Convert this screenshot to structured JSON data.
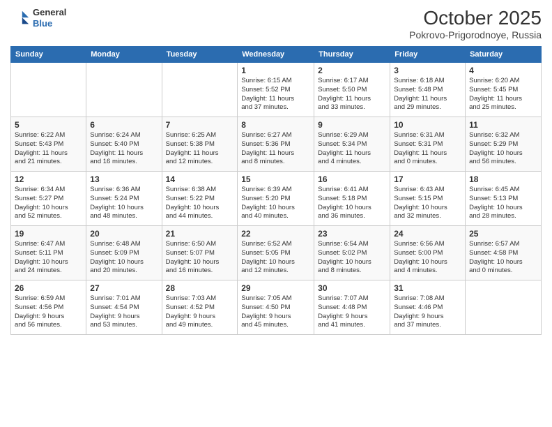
{
  "header": {
    "logo": {
      "line1": "General",
      "line2": "Blue"
    },
    "title": "October 2025",
    "location": "Pokrovo-Prigorodnoye, Russia"
  },
  "weekdays": [
    "Sunday",
    "Monday",
    "Tuesday",
    "Wednesday",
    "Thursday",
    "Friday",
    "Saturday"
  ],
  "weeks": [
    [
      {
        "day": "",
        "info": ""
      },
      {
        "day": "",
        "info": ""
      },
      {
        "day": "",
        "info": ""
      },
      {
        "day": "1",
        "info": "Sunrise: 6:15 AM\nSunset: 5:52 PM\nDaylight: 11 hours\nand 37 minutes."
      },
      {
        "day": "2",
        "info": "Sunrise: 6:17 AM\nSunset: 5:50 PM\nDaylight: 11 hours\nand 33 minutes."
      },
      {
        "day": "3",
        "info": "Sunrise: 6:18 AM\nSunset: 5:48 PM\nDaylight: 11 hours\nand 29 minutes."
      },
      {
        "day": "4",
        "info": "Sunrise: 6:20 AM\nSunset: 5:45 PM\nDaylight: 11 hours\nand 25 minutes."
      }
    ],
    [
      {
        "day": "5",
        "info": "Sunrise: 6:22 AM\nSunset: 5:43 PM\nDaylight: 11 hours\nand 21 minutes."
      },
      {
        "day": "6",
        "info": "Sunrise: 6:24 AM\nSunset: 5:40 PM\nDaylight: 11 hours\nand 16 minutes."
      },
      {
        "day": "7",
        "info": "Sunrise: 6:25 AM\nSunset: 5:38 PM\nDaylight: 11 hours\nand 12 minutes."
      },
      {
        "day": "8",
        "info": "Sunrise: 6:27 AM\nSunset: 5:36 PM\nDaylight: 11 hours\nand 8 minutes."
      },
      {
        "day": "9",
        "info": "Sunrise: 6:29 AM\nSunset: 5:34 PM\nDaylight: 11 hours\nand 4 minutes."
      },
      {
        "day": "10",
        "info": "Sunrise: 6:31 AM\nSunset: 5:31 PM\nDaylight: 11 hours\nand 0 minutes."
      },
      {
        "day": "11",
        "info": "Sunrise: 6:32 AM\nSunset: 5:29 PM\nDaylight: 10 hours\nand 56 minutes."
      }
    ],
    [
      {
        "day": "12",
        "info": "Sunrise: 6:34 AM\nSunset: 5:27 PM\nDaylight: 10 hours\nand 52 minutes."
      },
      {
        "day": "13",
        "info": "Sunrise: 6:36 AM\nSunset: 5:24 PM\nDaylight: 10 hours\nand 48 minutes."
      },
      {
        "day": "14",
        "info": "Sunrise: 6:38 AM\nSunset: 5:22 PM\nDaylight: 10 hours\nand 44 minutes."
      },
      {
        "day": "15",
        "info": "Sunrise: 6:39 AM\nSunset: 5:20 PM\nDaylight: 10 hours\nand 40 minutes."
      },
      {
        "day": "16",
        "info": "Sunrise: 6:41 AM\nSunset: 5:18 PM\nDaylight: 10 hours\nand 36 minutes."
      },
      {
        "day": "17",
        "info": "Sunrise: 6:43 AM\nSunset: 5:15 PM\nDaylight: 10 hours\nand 32 minutes."
      },
      {
        "day": "18",
        "info": "Sunrise: 6:45 AM\nSunset: 5:13 PM\nDaylight: 10 hours\nand 28 minutes."
      }
    ],
    [
      {
        "day": "19",
        "info": "Sunrise: 6:47 AM\nSunset: 5:11 PM\nDaylight: 10 hours\nand 24 minutes."
      },
      {
        "day": "20",
        "info": "Sunrise: 6:48 AM\nSunset: 5:09 PM\nDaylight: 10 hours\nand 20 minutes."
      },
      {
        "day": "21",
        "info": "Sunrise: 6:50 AM\nSunset: 5:07 PM\nDaylight: 10 hours\nand 16 minutes."
      },
      {
        "day": "22",
        "info": "Sunrise: 6:52 AM\nSunset: 5:05 PM\nDaylight: 10 hours\nand 12 minutes."
      },
      {
        "day": "23",
        "info": "Sunrise: 6:54 AM\nSunset: 5:02 PM\nDaylight: 10 hours\nand 8 minutes."
      },
      {
        "day": "24",
        "info": "Sunrise: 6:56 AM\nSunset: 5:00 PM\nDaylight: 10 hours\nand 4 minutes."
      },
      {
        "day": "25",
        "info": "Sunrise: 6:57 AM\nSunset: 4:58 PM\nDaylight: 10 hours\nand 0 minutes."
      }
    ],
    [
      {
        "day": "26",
        "info": "Sunrise: 6:59 AM\nSunset: 4:56 PM\nDaylight: 9 hours\nand 56 minutes."
      },
      {
        "day": "27",
        "info": "Sunrise: 7:01 AM\nSunset: 4:54 PM\nDaylight: 9 hours\nand 53 minutes."
      },
      {
        "day": "28",
        "info": "Sunrise: 7:03 AM\nSunset: 4:52 PM\nDaylight: 9 hours\nand 49 minutes."
      },
      {
        "day": "29",
        "info": "Sunrise: 7:05 AM\nSunset: 4:50 PM\nDaylight: 9 hours\nand 45 minutes."
      },
      {
        "day": "30",
        "info": "Sunrise: 7:07 AM\nSunset: 4:48 PM\nDaylight: 9 hours\nand 41 minutes."
      },
      {
        "day": "31",
        "info": "Sunrise: 7:08 AM\nSunset: 4:46 PM\nDaylight: 9 hours\nand 37 minutes."
      },
      {
        "day": "",
        "info": ""
      }
    ]
  ]
}
